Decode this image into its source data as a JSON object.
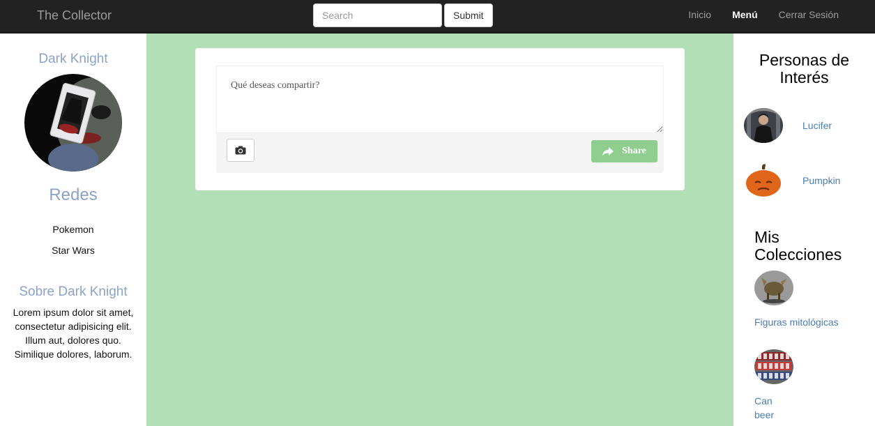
{
  "navbar": {
    "brand": "The Collector",
    "search_placeholder": "Search",
    "submit_label": "Submit",
    "links": [
      {
        "label": "Inicio"
      },
      {
        "label": "Menú"
      },
      {
        "label": "Cerrar Sesión"
      }
    ]
  },
  "profile": {
    "name": "Dark Knight",
    "redes_title": "Redes",
    "redes": [
      "Pokemon",
      "Star Wars"
    ],
    "about_title": "Sobre Dark Knight",
    "about_text": "Lorem ipsum dolor sit amet, consectetur adipisicing elit. Illum aut, dolores quo. Similique dolores, laborum."
  },
  "composer": {
    "placeholder": "Qué deseas compartir?",
    "share_label": "Share",
    "accent": "#8fce8f"
  },
  "right": {
    "personas_title": "Personas de Interés",
    "personas": [
      {
        "name": "Lucifer"
      },
      {
        "name": "Pumpkin"
      }
    ],
    "colecciones_title": "Mis Colecciones",
    "colecciones": [
      {
        "name": "Figuras mitológicas"
      },
      {
        "name": "Can beer"
      }
    ]
  },
  "icons": {
    "camera": "camera-icon",
    "share": "share-icon"
  },
  "colors": {
    "navbar": "#222222",
    "main_bg": "#b2dfb5",
    "heading_blue": "#8ba2c8",
    "link_blue": "#4a7db7"
  }
}
